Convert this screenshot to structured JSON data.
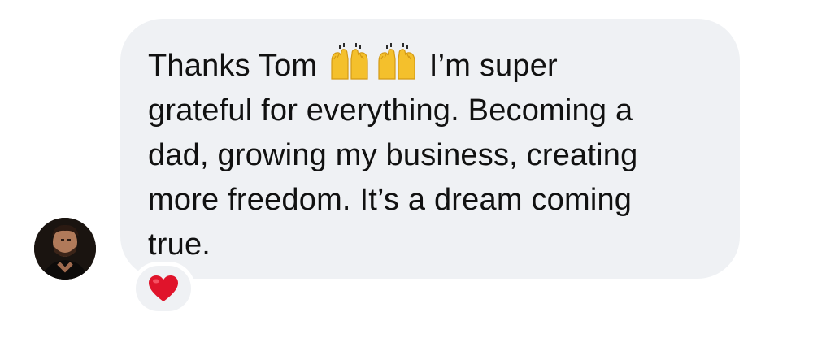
{
  "message": {
    "lines": [
      [
        "Thanks Tom",
        "I’m super"
      ],
      "grateful for everything. Becoming a",
      "dad, growing my business, creating",
      "more freedom. It’s a dream  coming",
      "true."
    ],
    "emojis": [
      "raising-hands-emoji",
      "raising-hands-emoji"
    ]
  },
  "reaction": {
    "emoji": "heart-emoji",
    "color": "#e0142b"
  },
  "bubble": {
    "background": "#eff1f4",
    "text_color": "#111111"
  }
}
